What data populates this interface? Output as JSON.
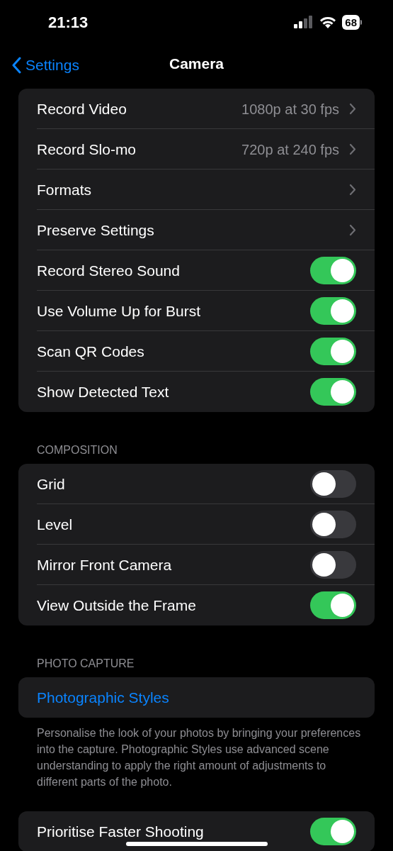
{
  "status_bar": {
    "time": "21:13",
    "battery": "68"
  },
  "nav": {
    "back": "Settings",
    "title": "Camera"
  },
  "groups": [
    {
      "rows": [
        {
          "kind": "value",
          "label": "Record Video",
          "value": "1080p at 30 fps"
        },
        {
          "kind": "value",
          "label": "Record Slo-mo",
          "value": "720p at 240 fps"
        },
        {
          "kind": "chevron",
          "label": "Formats"
        },
        {
          "kind": "chevron",
          "label": "Preserve Settings"
        },
        {
          "kind": "toggle",
          "label": "Record Stereo Sound",
          "on": true
        },
        {
          "kind": "toggle",
          "label": "Use Volume Up for Burst",
          "on": true
        },
        {
          "kind": "toggle",
          "label": "Scan QR Codes",
          "on": true
        },
        {
          "kind": "toggle",
          "label": "Show Detected Text",
          "on": true
        }
      ]
    },
    {
      "header": "COMPOSITION",
      "rows": [
        {
          "kind": "toggle",
          "label": "Grid",
          "on": false
        },
        {
          "kind": "toggle",
          "label": "Level",
          "on": false
        },
        {
          "kind": "toggle",
          "label": "Mirror Front Camera",
          "on": false
        },
        {
          "kind": "toggle",
          "label": "View Outside the Frame",
          "on": true
        }
      ]
    },
    {
      "header": "PHOTO CAPTURE",
      "rows": [
        {
          "kind": "link",
          "label": "Photographic Styles"
        }
      ],
      "footer": "Personalise the look of your photos by bringing your preferences into the capture. Photographic Styles use advanced scene understanding to apply the right amount of adjustments to different parts of the photo."
    },
    {
      "rows": [
        {
          "kind": "toggle",
          "label": "Prioritise Faster Shooting",
          "on": true
        }
      ]
    }
  ]
}
